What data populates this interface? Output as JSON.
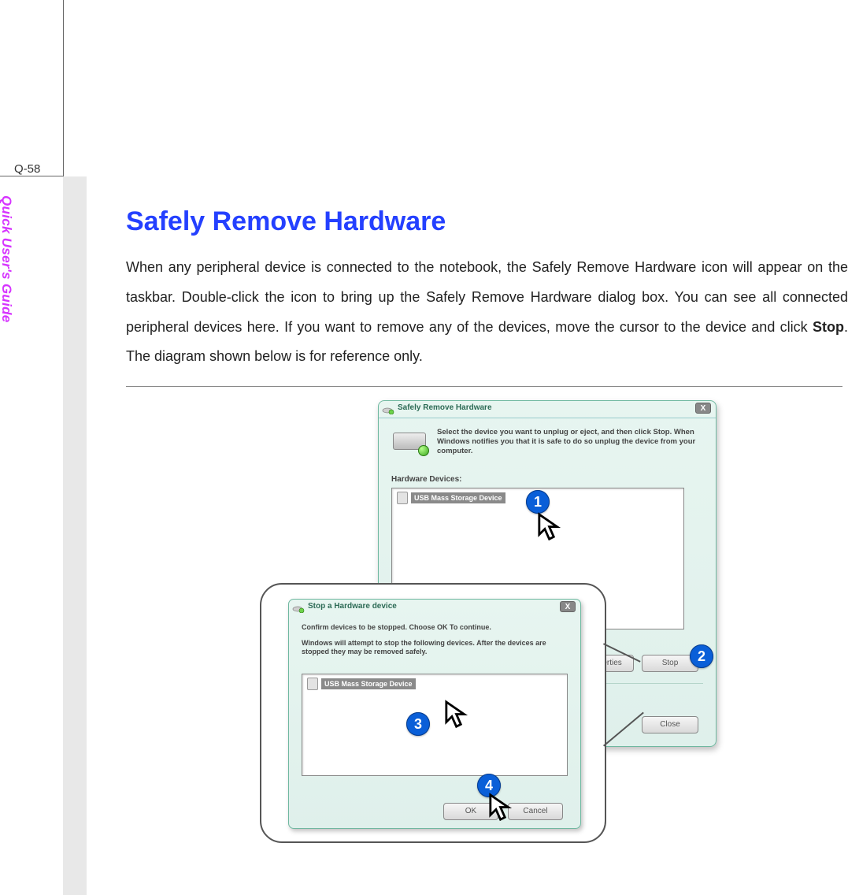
{
  "page_number": "Q-58",
  "side_label": "Quick User's Guide",
  "heading": "Safely Remove Hardware",
  "paragraph_pre": "When any peripheral device is connected to the notebook, the Safely Remove Hardware icon will appear on the taskbar.   Double-click the icon to bring up the Safely Remove Hardware dialog box.  You can see all connected peripheral devices here.   If you want to remove any of the devices, move the cursor to the device and click ",
  "paragraph_bold": "Stop",
  "paragraph_post": ".   The diagram shown below is for reference only.",
  "dlg_main": {
    "title": "Safely Remove Hardware",
    "guidance": "Select the device you want to unplug or eject, and then click Stop. When Windows notifies you that it is safe to do so unplug the device from your computer.",
    "hw_label": "Hardware Devices:",
    "item": "USB Mass Storage Device",
    "properties": "Properties",
    "stop": "Stop",
    "close": "Close"
  },
  "dlg_stop": {
    "title": "Stop a Hardware device",
    "line1": "Confirm devices to be stopped.  Choose OK To continue.",
    "line2": "Windows will attempt to stop the following devices. After the devices are stopped they may be removed safely.",
    "item": "USB Mass Storage Device",
    "ok": "OK",
    "cancel": "Cancel"
  },
  "badges": {
    "b1": "1",
    "b2": "2",
    "b3": "3",
    "b4": "4"
  },
  "chart_data": {
    "type": "diagram",
    "description": "Instructional Windows-style dialog sequence showing how to safely remove USB hardware",
    "steps": [
      {
        "n": 1,
        "action": "Select 'USB Mass Storage Device' in the Safely Remove Hardware device list"
      },
      {
        "n": 2,
        "action": "Click the Stop button in the Safely Remove Hardware dialog"
      },
      {
        "n": 3,
        "action": "In the Stop a Hardware device dialog, confirm 'USB Mass Storage Device' is selected"
      },
      {
        "n": 4,
        "action": "Click OK to stop the device"
      }
    ],
    "dialogs": [
      {
        "name": "Safely Remove Hardware",
        "buttons": [
          "Properties",
          "Stop",
          "Close"
        ],
        "list_items": [
          "USB Mass Storage Device"
        ]
      },
      {
        "name": "Stop a Hardware device",
        "buttons": [
          "OK",
          "Cancel"
        ],
        "list_items": [
          "USB Mass Storage Device"
        ]
      }
    ]
  }
}
